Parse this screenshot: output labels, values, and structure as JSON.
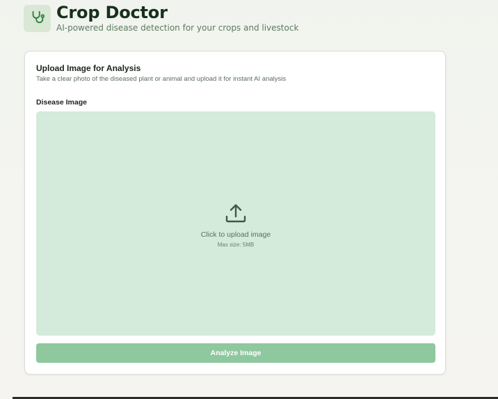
{
  "header": {
    "title": "Crop Doctor",
    "subtitle": "AI-powered disease detection for your crops and livestock",
    "logo_icon": "stethoscope-icon"
  },
  "upload_card": {
    "title": "Upload Image for Analysis",
    "description": "Take a clear photo of the diseased plant or animal and upload it for instant AI analysis",
    "field_label": "Disease Image",
    "dropzone": {
      "icon": "upload-icon",
      "text": "Click to upload image",
      "hint": "Max size: 5MB"
    },
    "analyze_button_label": "Analyze Image"
  },
  "colors": {
    "brand_green": "#2e7d3e",
    "dropzone_bg": "#d4eadb",
    "button_bg": "#8fc89e"
  }
}
